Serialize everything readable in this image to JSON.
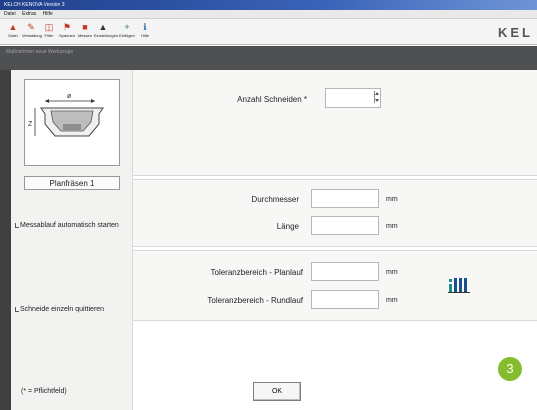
{
  "window": {
    "title": "KELCH KENOVA Version 3"
  },
  "menu": [
    "Datei",
    "Extras",
    "Hilfe"
  ],
  "toolbar": {
    "items": [
      {
        "label": "Datei",
        "icon": "measure-icon"
      },
      {
        "label": "Verwaltung",
        "icon": "tool-icon"
      },
      {
        "label": "Filter",
        "icon": "filter-icon"
      },
      {
        "label": "Spannen",
        "icon": "clamp-icon"
      },
      {
        "label": "Messen",
        "icon": "measure-head-icon"
      },
      {
        "label": "Einstellungen",
        "icon": "settings-icon"
      },
      {
        "label": "Einfügen",
        "icon": "add-icon"
      },
      {
        "label": "Hilfe",
        "icon": "info-icon"
      }
    ],
    "brand": "KEL"
  },
  "header": {
    "subtitle": "Maßnahmen  neue Werkzeuge"
  },
  "sidebar": {
    "caption": "Planfräsen 1",
    "auto_start_label": "Messablauf automatisch starten",
    "confirm_each_label": "Schneide einzeln quittieren",
    "required_note": "(* = Pflichtfeld)"
  },
  "form": {
    "cutters_label": "Anzahl Schneiden *",
    "cutters_value": "",
    "diameter_label": "Durchmesser",
    "diameter_unit": "mm",
    "length_label": "Länge",
    "length_unit": "mm",
    "tol_face_label": "Toleranzbereich - Planlauf",
    "tol_face_unit": "mm",
    "tol_radial_label": "Toleranzbereich - Rundlauf",
    "tol_radial_unit": "mm"
  },
  "ok_label": "OK",
  "step_badge": "3",
  "colors": {
    "accent_green": "#86bd2e",
    "meter_teal": "#1b8f8f"
  }
}
